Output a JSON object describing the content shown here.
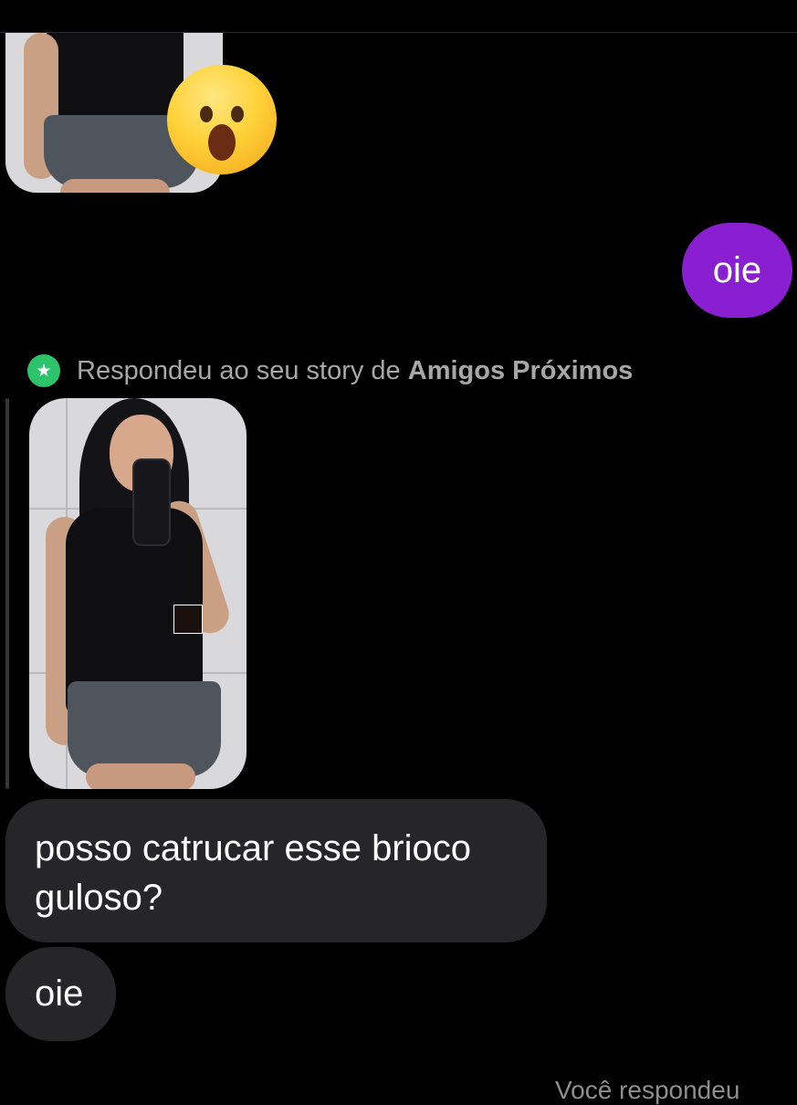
{
  "conversation": {
    "reaction": {
      "emoji": "😮",
      "icon": "astonished-face-icon"
    },
    "outgoing_message": {
      "text": "oie",
      "color": "#8a1fd1"
    },
    "story_reply": {
      "prefix": "Respondeu ao seu story de ",
      "list_name": "Amigos Próximos",
      "badge_icon": "star-icon",
      "badge_symbol": "★",
      "badge_color": "#2dc36b"
    },
    "incoming_messages": [
      {
        "text": "posso catrucar esse brioco guloso?"
      },
      {
        "text": "oie"
      }
    ],
    "footer_note": "Você respondeu"
  }
}
